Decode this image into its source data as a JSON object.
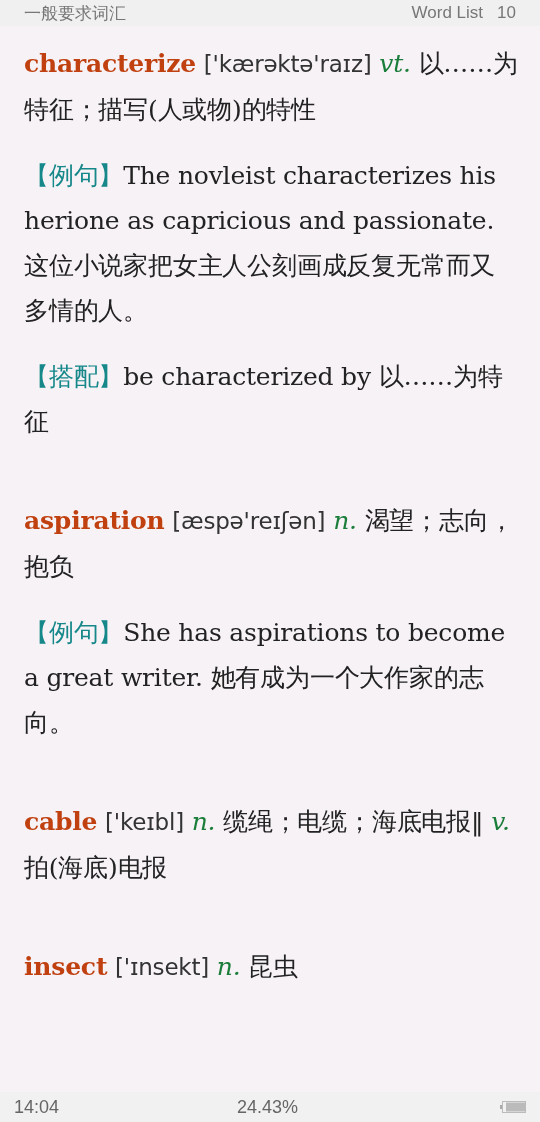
{
  "header": {
    "title": "一般要求词汇",
    "list_name": "Word List",
    "list_number": "10"
  },
  "entries": [
    {
      "word": "characterize",
      "phonetic": "['kærəktə'raɪz]",
      "senses": [
        {
          "pos": "vt.",
          "meaning": "以……为特征；描写(人或物)的特性"
        }
      ],
      "sections": [
        {
          "label": "【例句】",
          "text": "The novleist characterizes his herione as capricious and passionate. 这位小说家把女主人公刻画成反复无常而又多情的人。"
        },
        {
          "label": "【搭配】",
          "text": "be characterized by 以……为特征"
        }
      ]
    },
    {
      "word": "aspiration",
      "phonetic": "[æspə'reɪʃən]",
      "senses": [
        {
          "pos": "n.",
          "meaning": "渴望；志向，抱负"
        }
      ],
      "sections": [
        {
          "label": "【例句】",
          "text": "She has aspirations to become a great writer. 她有成为一个大作家的志向。"
        }
      ]
    },
    {
      "word": "cable",
      "phonetic": "['keɪbl]",
      "senses": [
        {
          "pos": "n.",
          "meaning": "缆绳；电缆；海底电报‖"
        },
        {
          "pos": "v.",
          "meaning": "拍(海底)电报"
        }
      ]
    },
    {
      "word": "insect",
      "phonetic": "['ɪnsekt]",
      "senses": [
        {
          "pos": "n.",
          "meaning": "昆虫"
        }
      ]
    }
  ],
  "footer": {
    "time": "14:04",
    "progress": "24.43%"
  }
}
